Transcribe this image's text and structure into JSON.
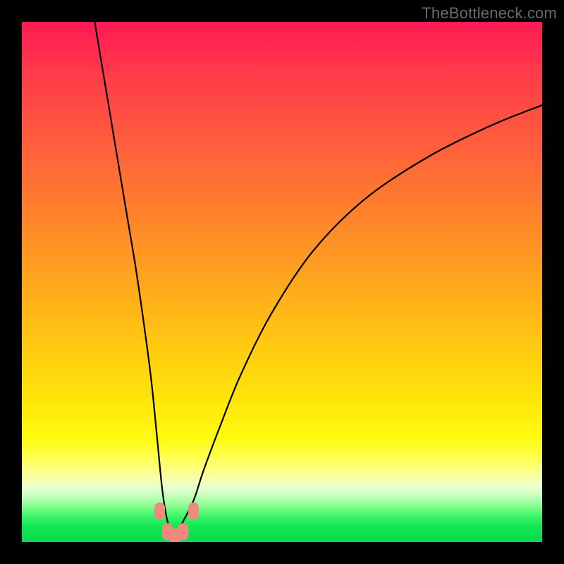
{
  "watermark": "TheBottleneck.com",
  "chart_data": {
    "type": "line",
    "title": "",
    "xlabel": "",
    "ylabel": "",
    "xlim": [
      0,
      100
    ],
    "ylim": [
      0,
      100
    ],
    "grid": false,
    "legend": false,
    "background": {
      "gradient_axis": "y",
      "stops": [
        {
          "pos": 0,
          "color": "#ff1a55"
        },
        {
          "pos": 22,
          "color": "#ff5a3e"
        },
        {
          "pos": 48,
          "color": "#ffa11f"
        },
        {
          "pos": 72,
          "color": "#ffe40a"
        },
        {
          "pos": 85,
          "color": "#ffff6a"
        },
        {
          "pos": 91,
          "color": "#c8ffbd"
        },
        {
          "pos": 100,
          "color": "#06db4c"
        }
      ]
    },
    "series": [
      {
        "name": "bottleneck-curve",
        "color": "#000000",
        "x": [
          14,
          16,
          18,
          20,
          22,
          24,
          25,
          26,
          27,
          28,
          29,
          30,
          31,
          33,
          35,
          38,
          42,
          48,
          56,
          66,
          78,
          90,
          100
        ],
        "y": [
          100,
          88,
          76,
          64,
          52,
          38,
          30,
          20,
          10,
          4,
          2,
          2,
          4,
          8,
          14,
          22,
          32,
          44,
          56,
          66,
          74,
          80,
          84
        ]
      }
    ],
    "markers": [
      {
        "name": "trough-marker",
        "x": 26.5,
        "y": 6,
        "color": "#ef8a7d"
      },
      {
        "name": "trough-marker",
        "x": 28.0,
        "y": 2,
        "color": "#ef8a7d"
      },
      {
        "name": "trough-marker",
        "x": 29.5,
        "y": 1,
        "color": "#ef8a7d"
      },
      {
        "name": "trough-marker",
        "x": 31.0,
        "y": 2,
        "color": "#ef8a7d"
      },
      {
        "name": "trough-marker",
        "x": 33.0,
        "y": 6,
        "color": "#ef8a7d"
      }
    ]
  }
}
